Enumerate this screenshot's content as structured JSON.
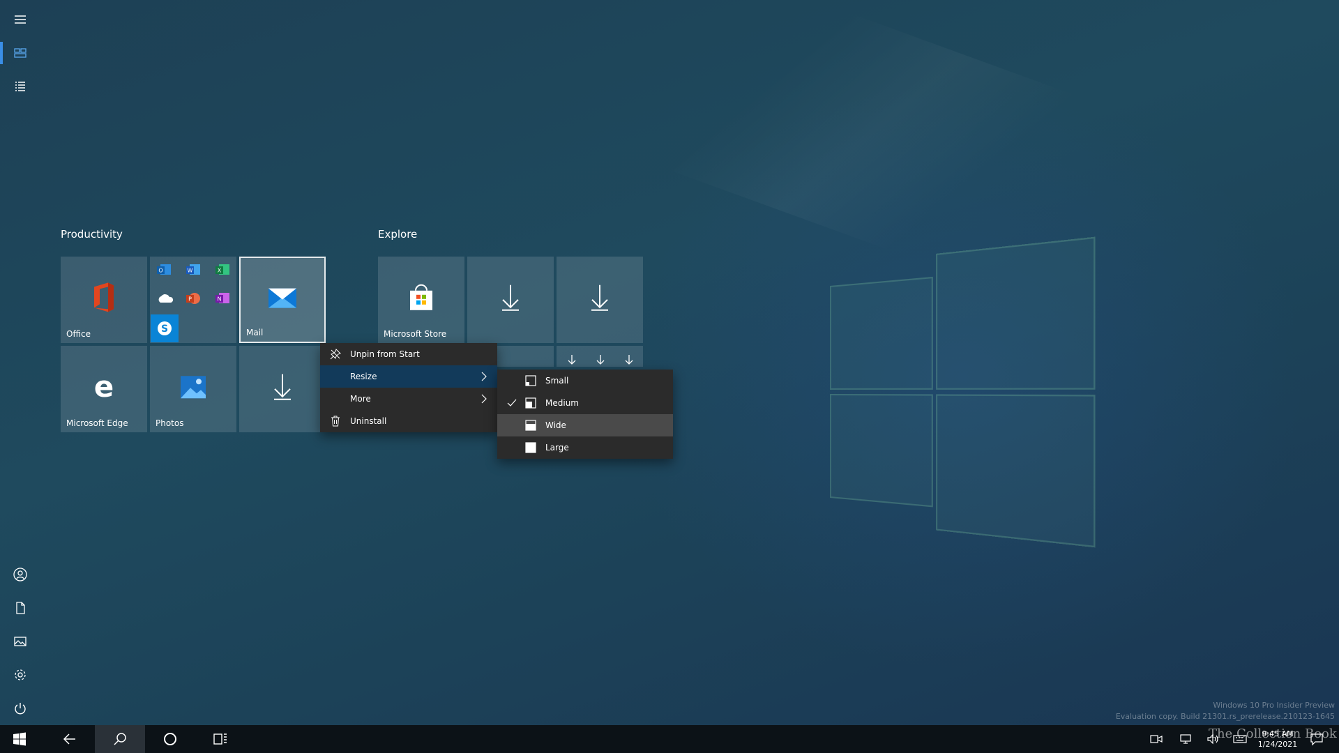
{
  "groups": {
    "productivity": {
      "title": "Productivity"
    },
    "explore": {
      "title": "Explore"
    }
  },
  "tiles": {
    "office": {
      "label": "Office"
    },
    "mail": {
      "label": "Mail"
    },
    "edge": {
      "label": "Microsoft Edge"
    },
    "photos": {
      "label": "Photos"
    },
    "store": {
      "label": "Microsoft Store"
    }
  },
  "context_menu": {
    "items": [
      {
        "label": "Unpin from Start",
        "icon": "unpin-icon"
      },
      {
        "label": "Resize",
        "submenu": true
      },
      {
        "label": "More",
        "submenu": true
      },
      {
        "label": "Uninstall",
        "icon": "trash-icon"
      }
    ]
  },
  "resize_menu": {
    "items": [
      {
        "label": "Small",
        "checked": false
      },
      {
        "label": "Medium",
        "checked": true
      },
      {
        "label": "Wide",
        "checked": false
      },
      {
        "label": "Large",
        "checked": false
      }
    ]
  },
  "taskbar": {
    "time": "9:45 AM",
    "date": "1/24/2021"
  },
  "watermark": {
    "line1": "Windows 10 Pro Insider Preview",
    "line2": "Evaluation copy. Build 21301.rs_prerelease.210123-1645"
  },
  "brand": "The Collection Book",
  "colors": {
    "accent": "#3a8ee6",
    "menu_bg": "#2b2b2b",
    "menu_highlight": "#123a5a"
  }
}
